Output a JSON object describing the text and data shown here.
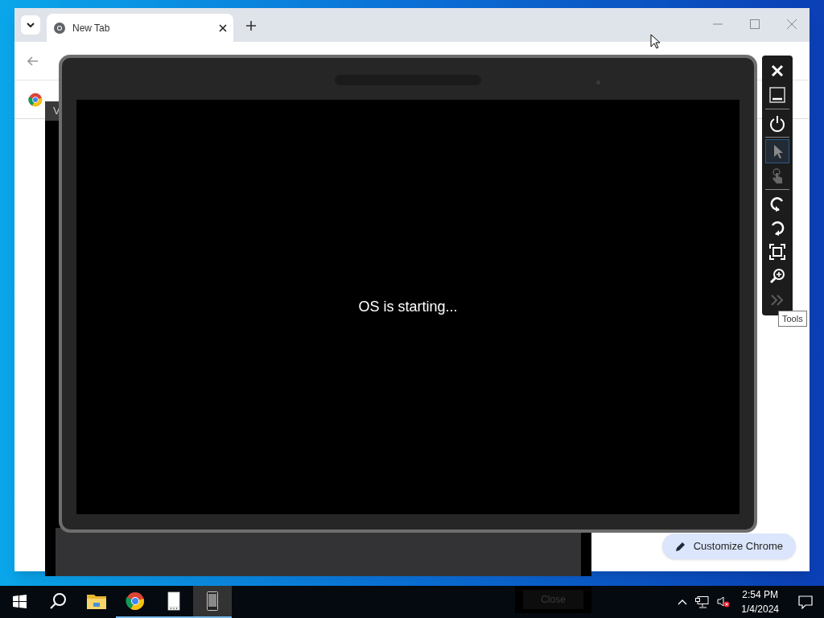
{
  "browser": {
    "tabs": [
      {
        "label": "New Tab",
        "selected": true
      }
    ],
    "customize_button": "Customize Chrome"
  },
  "dialog": {
    "title": "V",
    "button": "Close"
  },
  "emulator": {
    "screen_text": "OS is starting...",
    "tool_groups": [
      [
        {
          "kind": "close",
          "selected": false,
          "disabled": false
        },
        {
          "kind": "minimize",
          "selected": false,
          "disabled": false
        }
      ],
      [
        {
          "kind": "power",
          "selected": false,
          "disabled": false
        }
      ],
      [
        {
          "kind": "pointer",
          "selected": true,
          "disabled": false
        },
        {
          "kind": "touch",
          "selected": false,
          "disabled": true
        }
      ],
      [
        {
          "kind": "rotate-left",
          "selected": false,
          "disabled": false
        },
        {
          "kind": "rotate-right",
          "selected": false,
          "disabled": false
        },
        {
          "kind": "fit",
          "selected": false,
          "disabled": false
        },
        {
          "kind": "zoom",
          "selected": false,
          "disabled": false
        },
        {
          "kind": "more",
          "selected": false,
          "disabled": true
        }
      ]
    ],
    "tooltip": "Tools"
  },
  "taskbar": {
    "apps": [
      {
        "kind": "start",
        "running": false,
        "selected": false
      },
      {
        "kind": "search",
        "running": false,
        "selected": false
      },
      {
        "kind": "explorer",
        "running": false,
        "selected": false
      },
      {
        "kind": "chrome",
        "running": true,
        "selected": false
      },
      {
        "kind": "tablet",
        "running": true,
        "selected": false
      },
      {
        "kind": "emulator",
        "running": true,
        "selected": true
      }
    ],
    "clock": {
      "time": "2:54 PM",
      "date": "1/4/2024"
    }
  }
}
